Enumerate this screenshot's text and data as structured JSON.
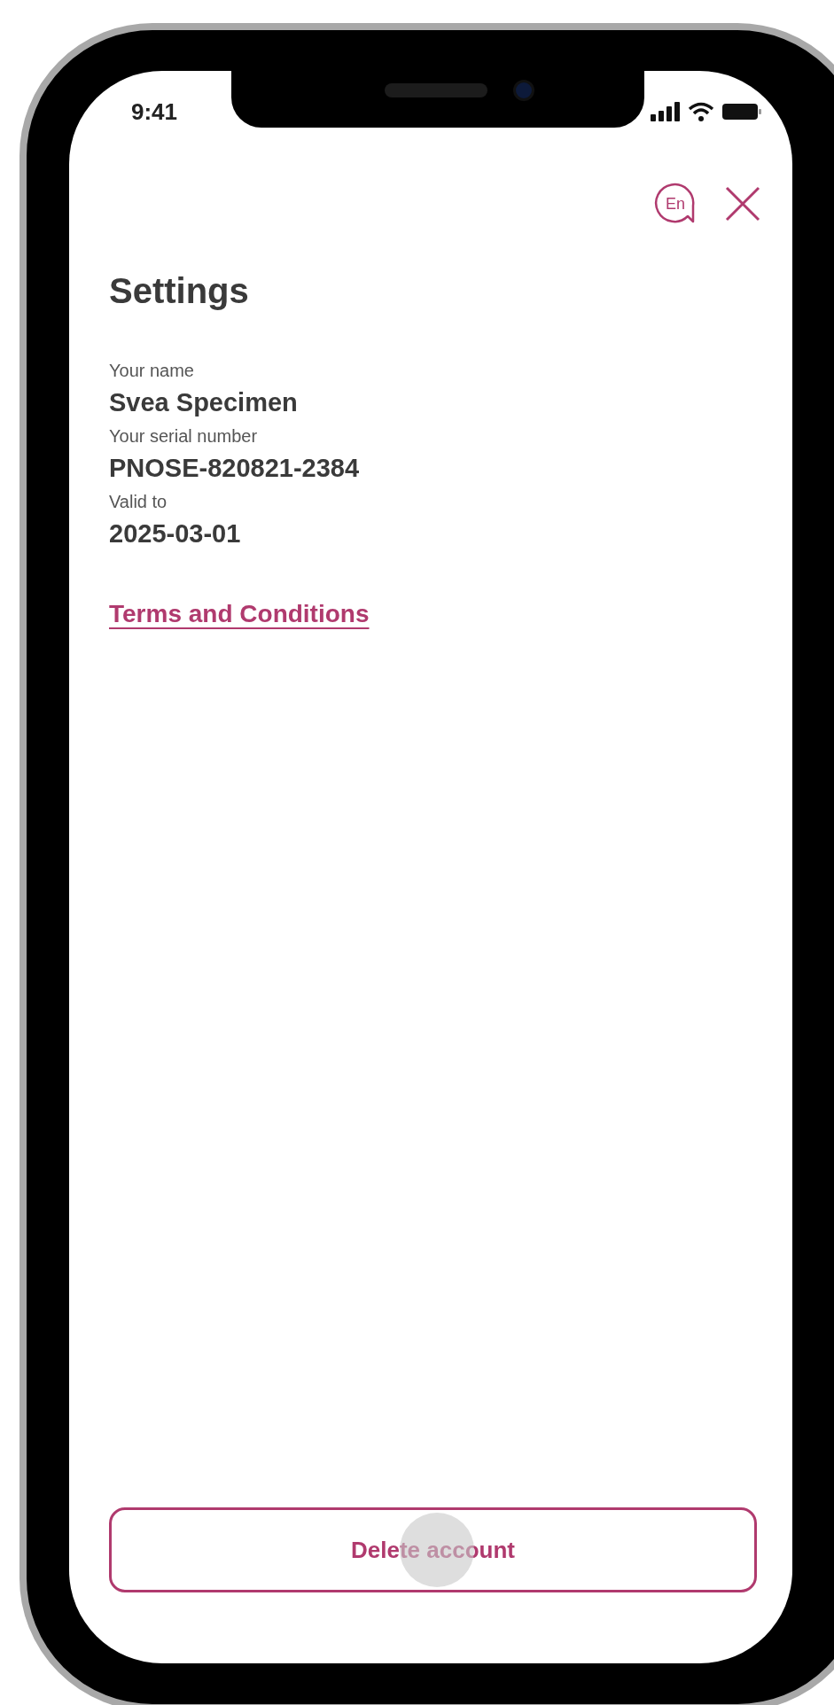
{
  "status_bar": {
    "time": "9:41"
  },
  "header": {
    "language": "En"
  },
  "title": "Settings",
  "fields": [
    {
      "label": "Your name",
      "value": "Svea Specimen"
    },
    {
      "label": "Your serial number",
      "value": "PNOSE-820821-2384"
    },
    {
      "label": "Valid to",
      "value": "2025-03-01"
    }
  ],
  "link": "Terms and Conditions",
  "button": {
    "label": "Delete account"
  }
}
